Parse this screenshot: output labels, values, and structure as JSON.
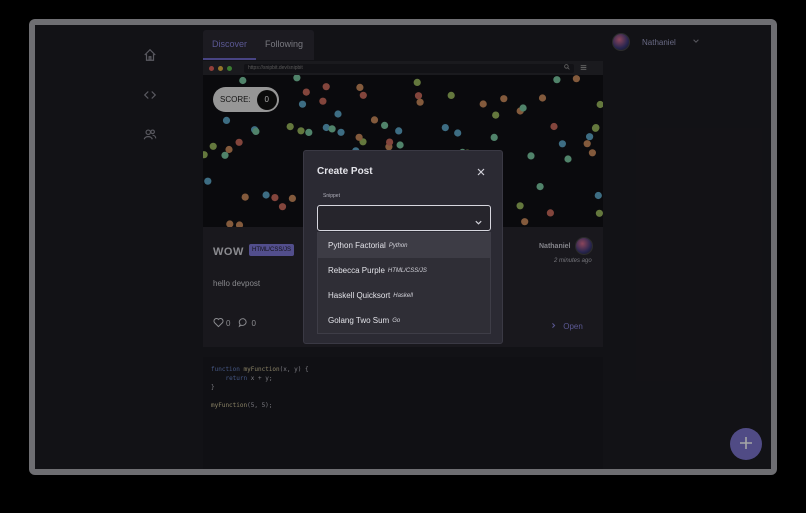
{
  "nav": {
    "icons": [
      "home-icon",
      "code-icon",
      "users-icon"
    ]
  },
  "header": {
    "tabs": [
      {
        "label": "Discover",
        "active": true
      },
      {
        "label": "Following",
        "active": false
      }
    ],
    "user": {
      "name": "Nathaniel"
    }
  },
  "browser": {
    "url": "https://snipbit.dev/snipbit",
    "score_label": "SCORE:",
    "score_value": "0"
  },
  "post": {
    "title": "WOW",
    "language": "HTML/CSS/JS",
    "body": "hello devpost",
    "author": "Nathaniel",
    "time": "2 minutes ago",
    "likes": "0",
    "comments": "0",
    "open_label": "Open"
  },
  "code": {
    "lines": [
      "function myFunction(x, y) {",
      "    return x + y;",
      "}",
      "",
      "myFunction(5, 5);"
    ]
  },
  "modal": {
    "title": "Create Post",
    "field_label": "Snippet",
    "select_value": "",
    "options": [
      {
        "name": "Python Factorial",
        "lang": "Python"
      },
      {
        "name": "Rebecca Purple",
        "lang": "HTML/CSS/JS"
      },
      {
        "name": "Haskell Quicksort",
        "lang": "Haskell"
      },
      {
        "name": "Golang Two Sum",
        "lang": "Go"
      }
    ]
  },
  "colors": {
    "accent": "#7b74cc",
    "background": "#1d1c22",
    "card": "#27262d",
    "modal": "#2b2a33"
  }
}
